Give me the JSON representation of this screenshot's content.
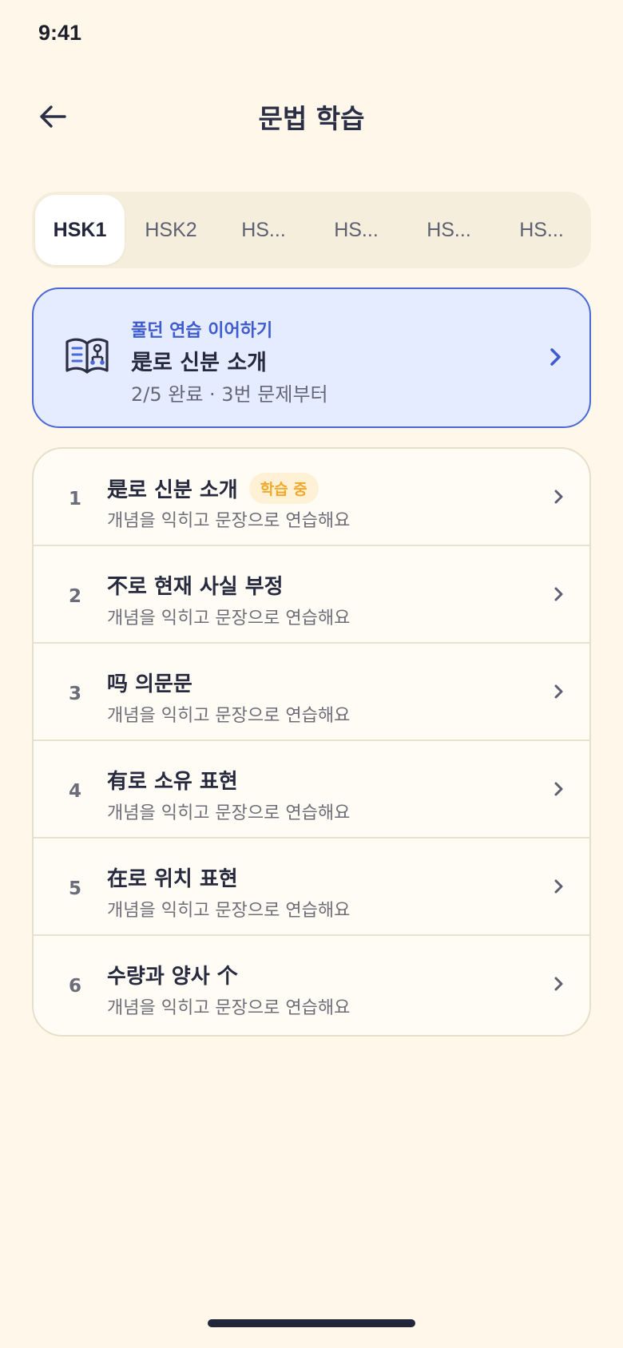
{
  "status_bar": {
    "time": "9:41"
  },
  "header": {
    "title": "문법 학습"
  },
  "tabs": [
    {
      "label": "HSK1",
      "active": true
    },
    {
      "label": "HSK2",
      "active": false
    },
    {
      "label": "HS...",
      "active": false
    },
    {
      "label": "HS...",
      "active": false
    },
    {
      "label": "HS...",
      "active": false
    },
    {
      "label": "HS...",
      "active": false
    }
  ],
  "resume": {
    "kicker": "풀던 연습 이어하기",
    "title": "是로 신분 소개",
    "subtitle": "2/5 완료 · 3번 문제부터",
    "icon": "book-icon"
  },
  "lessons": [
    {
      "number": "1",
      "title": "是로 신분 소개",
      "badge": "학습 중",
      "subtitle": "개념을 익히고 문장으로 연습해요"
    },
    {
      "number": "2",
      "title": "不로 현재 사실 부정",
      "subtitle": "개념을 익히고 문장으로 연습해요"
    },
    {
      "number": "3",
      "title": "吗 의문문",
      "subtitle": "개념을 익히고 문장으로 연습해요"
    },
    {
      "number": "4",
      "title": "有로 소유 표현",
      "subtitle": "개념을 익히고 문장으로 연습해요"
    },
    {
      "number": "5",
      "title": "在로 위치 표현",
      "subtitle": "개념을 익히고 문장으로 연습해요"
    },
    {
      "number": "6",
      "title": "수량과 양사 个",
      "subtitle": "개념을 익히고 문장으로 연습해요"
    }
  ],
  "colors": {
    "background": "#FFF8EA",
    "accent": "#4A68D8",
    "badge_text": "#F0A92A",
    "badge_bg": "#FFF1D6"
  }
}
